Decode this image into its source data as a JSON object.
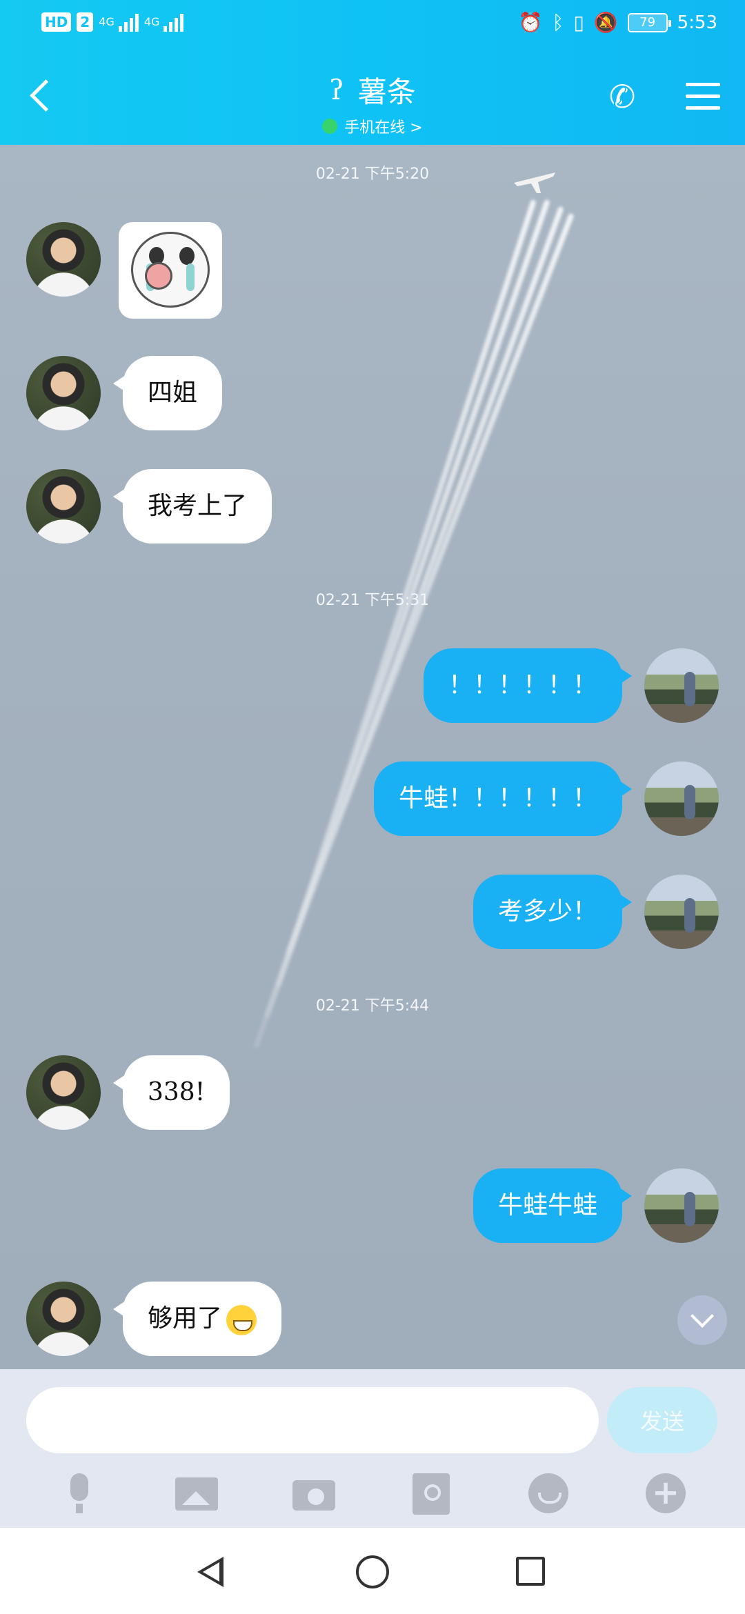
{
  "status_bar": {
    "hd": "HD",
    "sim": "2",
    "net1": "4G",
    "net2": "4G",
    "battery": "79",
    "time": "5:53"
  },
  "header": {
    "title": "薯条",
    "status": "手机在线 >",
    "icons": [
      "back-icon",
      "ear-icon",
      "phone-icon",
      "menu-icon"
    ]
  },
  "messages": {
    "timestamps": [
      "02-21 下午5:20",
      "02-21 下午5:31",
      "02-21 下午5:44"
    ],
    "m1": "四姐",
    "m2": "我考上了",
    "m3": "！！！！！！",
    "m4": "牛蛙！！！！！！",
    "m5": "考多少！",
    "m6": "338!",
    "m7": "牛蛙牛蛙",
    "m8": "够用了"
  },
  "input": {
    "value": "",
    "placeholder": "",
    "send": "发送"
  },
  "toolbar": {
    "icons": [
      "microphone-icon",
      "image-icon",
      "camera-icon",
      "red-packet-icon",
      "emoji-icon",
      "plus-icon"
    ]
  },
  "colors": {
    "header": "#14c9f2",
    "bubble_out": "#1ab0f4",
    "bubble_in": "#ffffff",
    "online": "#37d46b"
  }
}
